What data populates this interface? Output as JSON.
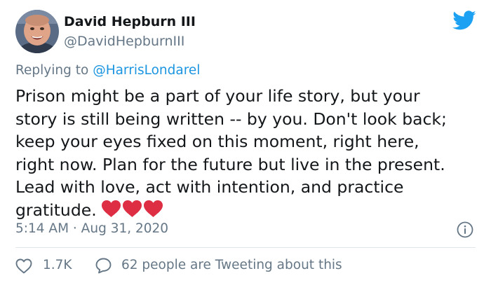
{
  "author": {
    "name": "David Hepburn III",
    "handle": "@DavidHepburnIII"
  },
  "reply": {
    "prefix": "Replying to ",
    "mention": "@HarrisLondarel"
  },
  "tweet": {
    "text": "Prison might be a part of your life story, but your\nstory is still being written -- by you. Don't look back;\nkeep your eyes fixed on this moment, right here,\nright now. Plan for the future but live in the present.\nLead with love, act with intention, and practice\ngratitude.",
    "emoji": [
      "heart",
      "heart",
      "heart"
    ],
    "timestamp": "5:14 AM · Aug 31, 2020"
  },
  "actions": {
    "like_count": "1.7K",
    "conversation_text": "62 people are Tweeting about this"
  },
  "icons": {
    "brand": "twitter-bird-icon",
    "info": "info-icon",
    "like": "heart-outline-icon",
    "comment": "comment-bubble-icon"
  },
  "colors": {
    "twitter_blue": "#1da1f2",
    "mention_blue": "#1b95e0",
    "secondary_text": "#657786",
    "primary_text": "#14171a",
    "heart_red": "#dd2e44",
    "divider": "#e1e8ed"
  }
}
